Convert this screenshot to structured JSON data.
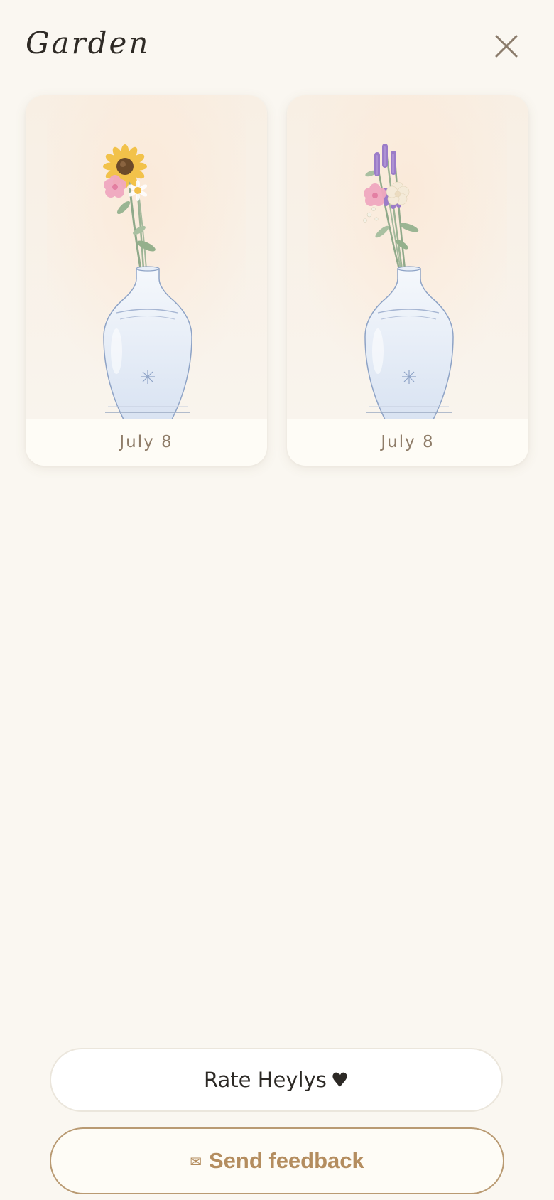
{
  "header": {
    "title": "Garden",
    "close_icon": "close-icon"
  },
  "garden": {
    "cards": [
      {
        "date": "July 8",
        "flowers": [
          "sunflower",
          "pink-flower",
          "yellow-daisy"
        ],
        "vase": "blue-glass-vase"
      },
      {
        "date": "July 8",
        "flowers": [
          "lavender",
          "pink-flower",
          "white-flower"
        ],
        "vase": "blue-glass-vase"
      }
    ]
  },
  "actions": {
    "rate_label": "Rate Heylys",
    "rate_icon": "♥",
    "feedback_label": "Send feedback",
    "feedback_icon": "✉"
  },
  "colors": {
    "background": "#faf7f1",
    "card": "#fefcf6",
    "accent": "#b48d5f",
    "text": "#2e2a25",
    "muted": "#8f7d69"
  }
}
